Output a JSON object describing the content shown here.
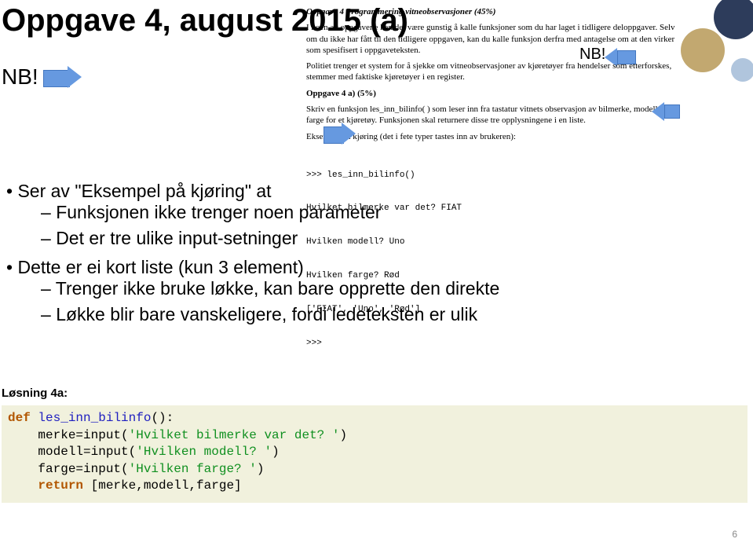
{
  "title": "Oppgave 4, august 2015 (a)",
  "nb_left": "NB!",
  "nb_right": "NB!",
  "page_number": "6",
  "problem_panel": {
    "heading": "Oppgave 4 Programmering vitneobservasjoner (45%)",
    "intro_p1": "I noen av oppgavene kan det være gunstig å kalle funksjoner som du har laget i tidligere deloppgaver. Selv om du ikke har fått til den tidligere oppgaven, kan du kalle funksjon derfra med antagelse om at den virker som spesifisert i oppgaveteksten.",
    "intro_p2": "Politiet trenger et system for å sjekke om vitneobservasjoner av kjøretøyer fra hendelser som etterforskes, stemmer med faktiske kjøretøyer i en register.",
    "subheading": "Oppgave 4 a) (5%)",
    "task_p1": "Skriv en funksjon les_inn_bilinfo( ) som leser inn fra tastatur vitnets observasjon av bilmerke, modell og farge for et kjøretøy. Funksjonen skal returnere disse tre opplysningene i en liste.",
    "task_p2": "Eksempel på kjøring (det i fete typer tastes inn av brukeren):",
    "code_lines": [
      ">>> les_inn_bilinfo()",
      "Hvilket bilmerke var det? FIAT",
      "Hvilken modell? Uno",
      "Hvilken farge? Rød",
      "['FIAT', 'Uno', 'Rød']",
      ">>>"
    ]
  },
  "bullets": {
    "b1": "Ser av \"Eksempel på kjøring\" at",
    "b1s1": "Funksjonen ikke trenger noen parameter",
    "b1s2": "Det er tre ulike input-setninger",
    "b2": "Dette er ei kort liste (kun 3 element)",
    "b2s1": "Trenger ikke bruke løkke, kan bare opprette den direkte",
    "b2s2": "Løkke blir bare vanskeligere, fordi ledeteksten er ulik"
  },
  "solution": {
    "label": "Løsning 4a:",
    "line_def": "def les_inn_bilinfo():",
    "line_merke": "    merke=input('Hvilket bilmerke var det? ')",
    "line_modell": "    modell=input('Hvilken modell? ')",
    "line_farge": "    farge=input('Hvilken farge? ')",
    "line_return": "    return [merke,modell,farge]"
  }
}
